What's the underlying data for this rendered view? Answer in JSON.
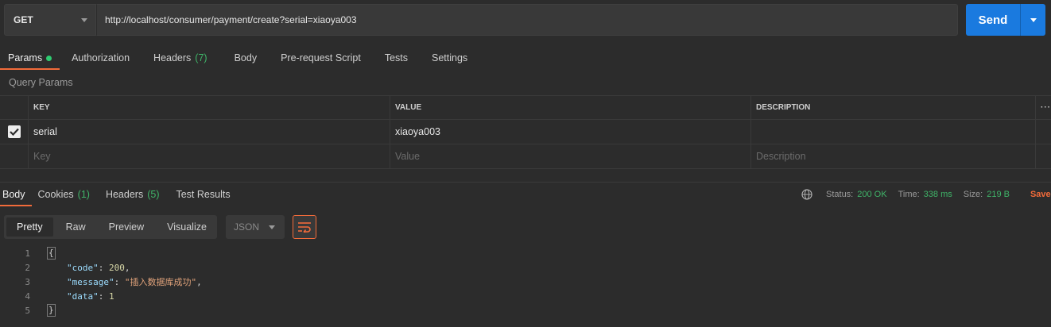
{
  "request": {
    "method": "GET",
    "url": "http://localhost/consumer/payment/create?serial=xiaoya003",
    "send_label": "Send"
  },
  "request_tabs": [
    {
      "label": "Params",
      "active": true,
      "dot": true
    },
    {
      "label": "Authorization"
    },
    {
      "label": "Headers",
      "count": "(7)"
    },
    {
      "label": "Body"
    },
    {
      "label": "Pre-request Script"
    },
    {
      "label": "Tests"
    },
    {
      "label": "Settings"
    }
  ],
  "query_params": {
    "title": "Query Params",
    "headers": {
      "key": "KEY",
      "value": "VALUE",
      "description": "DESCRIPTION",
      "more": "···"
    },
    "rows": [
      {
        "checked": true,
        "key": "serial",
        "value": "xiaoya003",
        "description": ""
      }
    ],
    "placeholder": {
      "key": "Key",
      "value": "Value",
      "description": "Description"
    }
  },
  "response_tabs": [
    {
      "label": "Body",
      "active": true
    },
    {
      "label": "Cookies",
      "count": "(1)"
    },
    {
      "label": "Headers",
      "count": "(5)"
    },
    {
      "label": "Test Results"
    }
  ],
  "response_meta": {
    "status_label": "Status:",
    "status": "200 OK",
    "time_label": "Time:",
    "time": "338 ms",
    "size_label": "Size:",
    "size": "219 B",
    "save": "Save"
  },
  "body_view": {
    "modes": [
      "Pretty",
      "Raw",
      "Preview",
      "Visualize"
    ],
    "active_mode": "Pretty",
    "format": "JSON"
  },
  "code": {
    "line_numbers": [
      "1",
      "2",
      "3",
      "4",
      "5"
    ],
    "open_brace": "{",
    "close_brace": "}",
    "k_code": "\"code\"",
    "v_code": "200",
    "k_message": "\"message\"",
    "v_message": "\"插入数据库成功\"",
    "k_data": "\"data\"",
    "v_data": "1"
  },
  "colors": {
    "accent": "#f26b3a",
    "send": "#1a7adf",
    "success": "#3fb468"
  }
}
